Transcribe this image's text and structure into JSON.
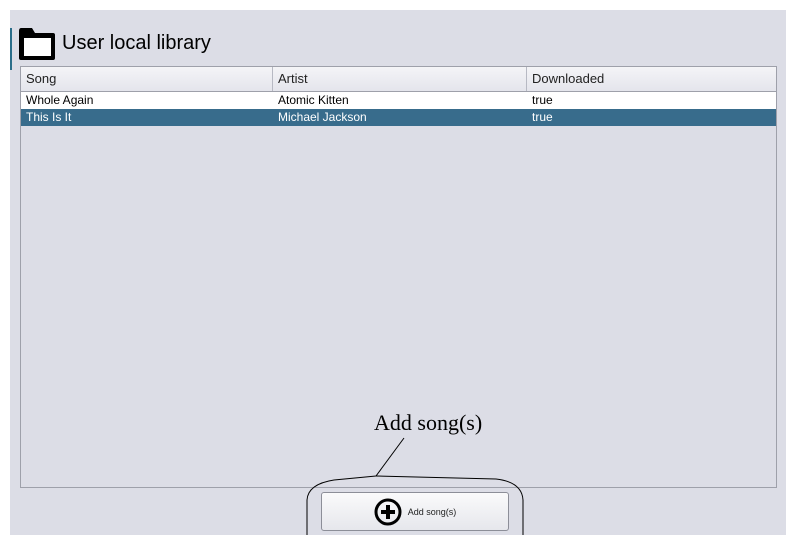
{
  "library": {
    "title": "User local library",
    "icon": "folder-icon"
  },
  "table": {
    "columns": [
      "Song",
      "Artist",
      "Downloaded"
    ],
    "rows": [
      {
        "song": "Whole Again",
        "artist": "Atomic Kitten",
        "downloaded": "true",
        "selected": false
      },
      {
        "song": "This Is It",
        "artist": "Michael Jackson",
        "downloaded": "true",
        "selected": true
      }
    ]
  },
  "annotation": {
    "label": "Add song(s)"
  },
  "add_button": {
    "label": "Add song(s)",
    "icon": "plus-circle-icon"
  },
  "colors": {
    "selection": "#386c8c",
    "panel": "#dcdde6"
  }
}
